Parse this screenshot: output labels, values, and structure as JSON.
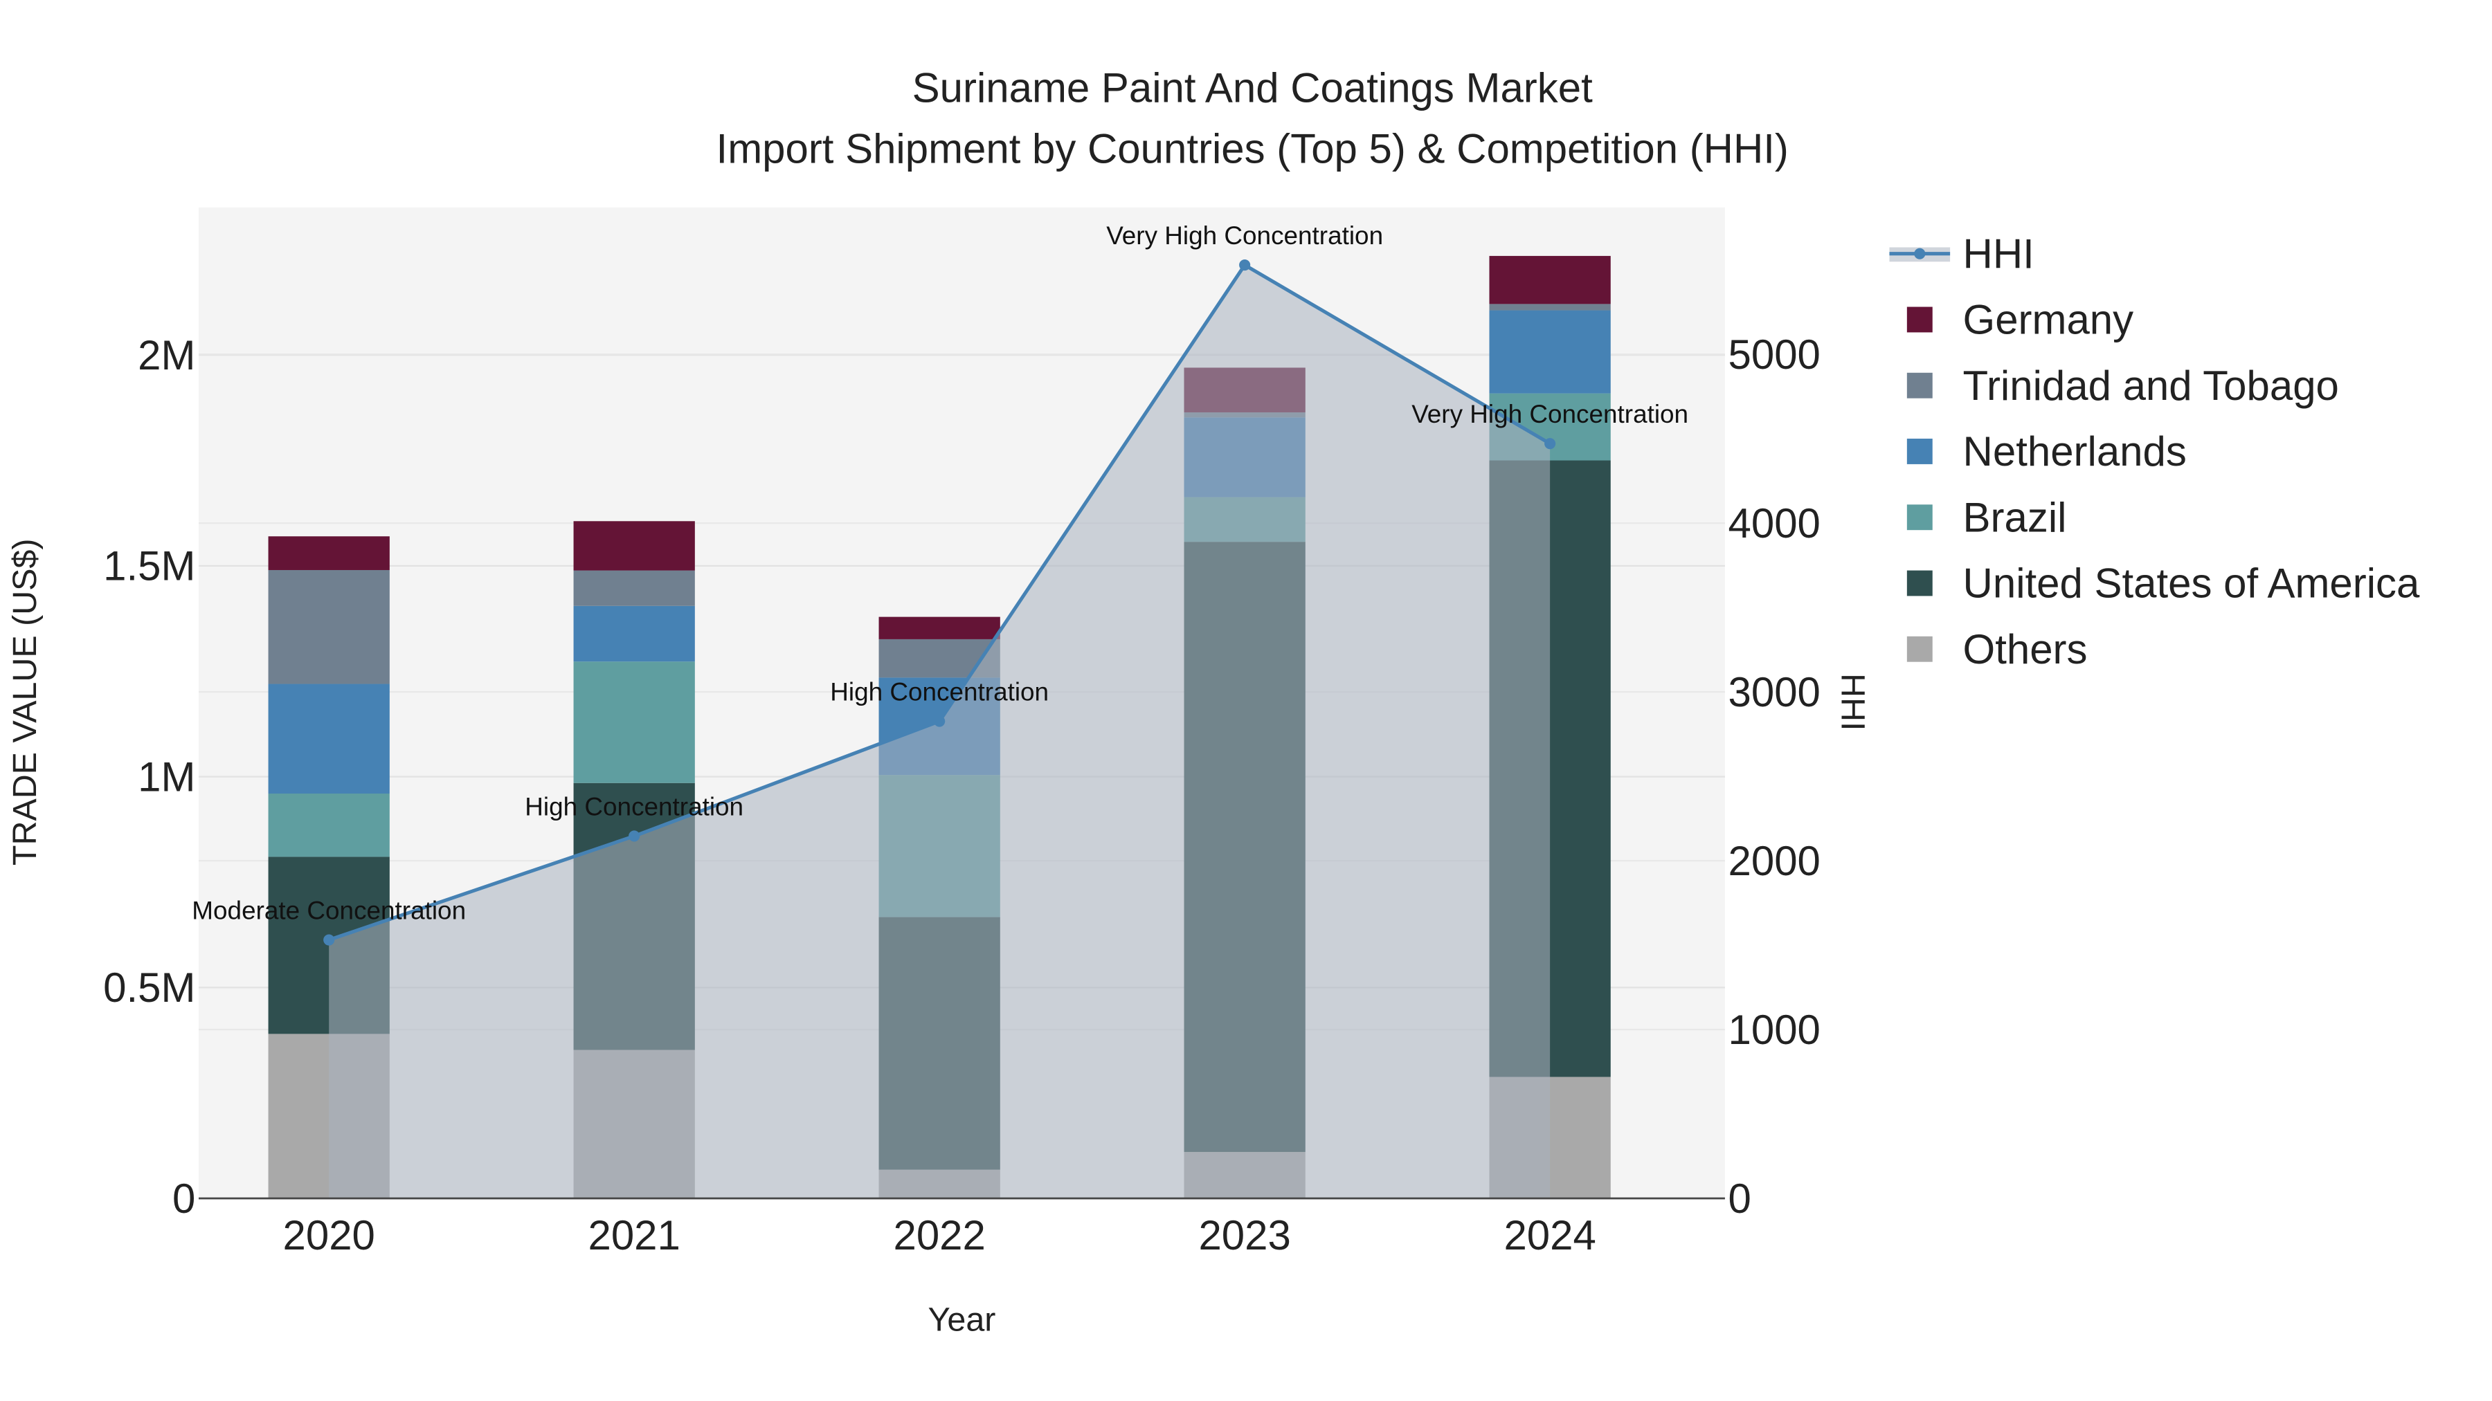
{
  "chart_data": {
    "type": "bar",
    "title": "Suriname Paint And Coatings Market",
    "subtitle": "Import Shipment by Countries (Top 5) & Competition (HHI)",
    "xlabel": "Year",
    "ylabel": "TRADE VALUE (US$)",
    "y2label": "HHI",
    "categories": [
      "2020",
      "2021",
      "2022",
      "2023",
      "2024"
    ],
    "ylim": [
      0,
      2350000
    ],
    "y2lim": [
      0,
      5870
    ],
    "yticks": [
      {
        "v": 0,
        "label": "0"
      },
      {
        "v": 500000,
        "label": "0.5M"
      },
      {
        "v": 1000000,
        "label": "1M"
      },
      {
        "v": 1500000,
        "label": "1.5M"
      },
      {
        "v": 2000000,
        "label": "2M"
      }
    ],
    "y2ticks": [
      0,
      1000,
      2000,
      3000,
      4000,
      5000
    ],
    "stacked": true,
    "series": [
      {
        "name": "Others",
        "color": "#A9A9A9",
        "values": [
          390000,
          352000,
          68000,
          110000,
          288000
        ]
      },
      {
        "name": "United States of America",
        "color": "#2F4F4F",
        "values": [
          420000,
          633000,
          599000,
          1447000,
          1462000
        ]
      },
      {
        "name": "Brazil",
        "color": "#5F9EA0",
        "values": [
          150000,
          288000,
          337000,
          106000,
          159000
        ]
      },
      {
        "name": "Netherlands",
        "color": "#4682B4",
        "values": [
          260000,
          132000,
          231000,
          189000,
          197000
        ]
      },
      {
        "name": "Trinidad and Tobago",
        "color": "#708090",
        "values": [
          270000,
          84000,
          91000,
          12000,
          15000
        ]
      },
      {
        "name": "Germany",
        "color": "#641436",
        "values": [
          80000,
          117000,
          53000,
          106000,
          114000
        ]
      }
    ],
    "hhi": {
      "name": "HHI",
      "color": "#4682B4",
      "values": [
        1531,
        2146,
        2826,
        5529,
        4471
      ],
      "annotations": [
        "Moderate Concentration",
        "High Concentration",
        "High Concentration",
        "Very High Concentration",
        "Very High Concentration"
      ]
    },
    "legend": {
      "placement": "right",
      "order": [
        "HHI",
        "Germany",
        "Trinidad and Tobago",
        "Netherlands",
        "Brazil",
        "United States of America",
        "Others"
      ]
    }
  }
}
